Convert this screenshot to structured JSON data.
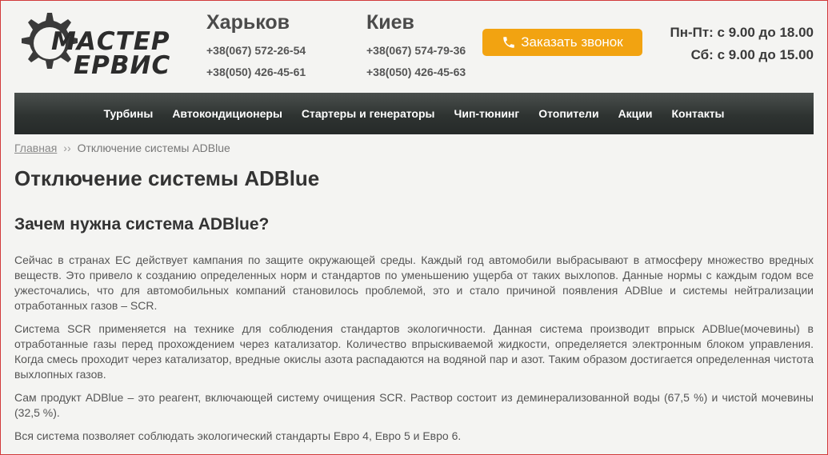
{
  "logo": {
    "line1": "МАСТЕР",
    "line2": "ЕРВИС"
  },
  "contacts": {
    "kharkov": {
      "city": "Харьков",
      "phone1": "+38(067) 572-26-54",
      "phone2": "+38(050) 426-45-61"
    },
    "kiev": {
      "city": "Киев",
      "phone1": "+38(067) 574-79-36",
      "phone2": "+38(050) 426-45-63"
    }
  },
  "call_button": {
    "label": "Заказать звонок",
    "icon": "phone-icon"
  },
  "hours": {
    "weekdays": "Пн-Пт: с 9.00 до 18.00",
    "saturday": "Сб: с 9.00 до 15.00"
  },
  "nav": {
    "items": [
      "Турбины",
      "Автокондиционеры",
      "Стартеры и генераторы",
      "Чип-тюнинг",
      "Отопители",
      "Акции",
      "Контакты"
    ]
  },
  "breadcrumb": {
    "home": "Главная",
    "separator": "››",
    "current": "Отключение системы ADBlue"
  },
  "page": {
    "title": "Отключение системы ADBlue",
    "subtitle": "Зачем нужна система ADBlue?",
    "paragraphs": [
      "Сейчас в странах ЕС действует кампания по защите окружающей среды. Каждый год автомобили выбрасывают в атмосферу множество вредных веществ. Это привело к созданию определенных норм и стандартов по уменьшению ущерба от таких выхлопов. Данные нормы с каждым годом все ужесточались, что для автомобильных компаний становилось проблемой, это и стало причиной появления ADBlue и системы нейтрализации отработанных газов – SCR.",
      "Система SCR применяется на технике для соблюдения стандартов экологичности. Данная система производит впрыск ADBlue(мочевины) в отработанные газы перед прохождением через катализатор. Количество впрыскиваемой жидкости, определяется электронным блоком управления. Когда смесь проходит через катализатор, вредные окислы азота распадаются на водяной пар и азот. Таким образом достигается определенная чистота выхлопных газов.",
      "Сам продукт ADBlue – это реагент, включающей систему очищения SCR. Раствор состоит из деминерализованной воды (67,5 %) и чистой мочевины (32,5 %).",
      "Вся система позволяет соблюдать экологический стандарты Евро 4, Евро 5 и Евро 6."
    ]
  },
  "colors": {
    "accent": "#f2a311",
    "nav_bg": "#2e3331",
    "frame": "#d23a3a"
  }
}
